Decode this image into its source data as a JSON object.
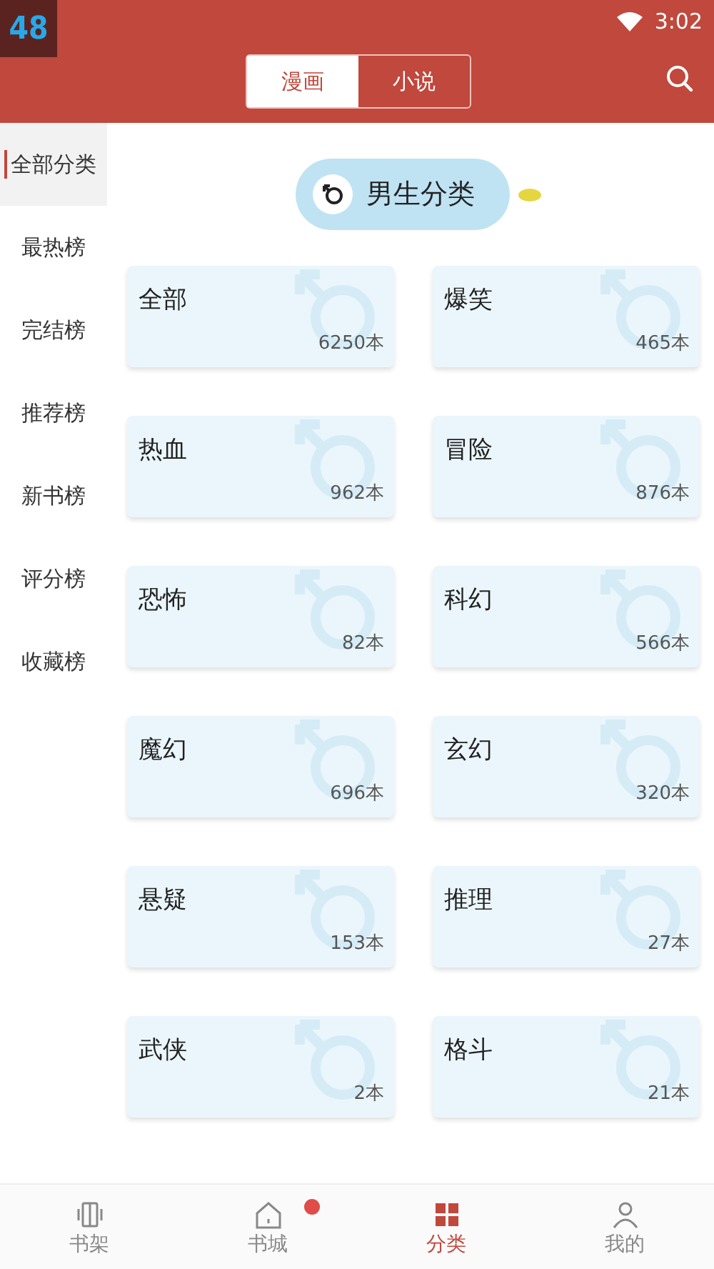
{
  "status_bar": {
    "badge": "48",
    "time": "3:02"
  },
  "header_tabs": [
    {
      "label": "漫画",
      "selected": true
    },
    {
      "label": "小说",
      "selected": false
    }
  ],
  "sidebar": {
    "items": [
      {
        "label": "全部分类",
        "selected": true
      },
      {
        "label": "最热榜",
        "selected": false
      },
      {
        "label": "完结榜",
        "selected": false
      },
      {
        "label": "推荐榜",
        "selected": false
      },
      {
        "label": "新书榜",
        "selected": false
      },
      {
        "label": "评分榜",
        "selected": false
      },
      {
        "label": "收藏榜",
        "selected": false
      }
    ]
  },
  "section_title": "男生分类",
  "categories": [
    {
      "name": "全部",
      "count": "6250本"
    },
    {
      "name": "爆笑",
      "count": "465本"
    },
    {
      "name": "热血",
      "count": "962本"
    },
    {
      "name": "冒险",
      "count": "876本"
    },
    {
      "name": "恐怖",
      "count": "82本"
    },
    {
      "name": "科幻",
      "count": "566本"
    },
    {
      "name": "魔幻",
      "count": "696本"
    },
    {
      "name": "玄幻",
      "count": "320本"
    },
    {
      "name": "悬疑",
      "count": "153本"
    },
    {
      "name": "推理",
      "count": "27本"
    },
    {
      "name": "武侠",
      "count": "2本"
    },
    {
      "name": "格斗",
      "count": "21本"
    }
  ],
  "bottom_nav": [
    {
      "label": "书架",
      "kind": "shelf",
      "selected": false,
      "dot": false
    },
    {
      "label": "书城",
      "kind": "home",
      "selected": false,
      "dot": true
    },
    {
      "label": "分类",
      "kind": "category",
      "selected": true,
      "dot": false
    },
    {
      "label": "我的",
      "kind": "profile",
      "selected": false,
      "dot": false
    }
  ]
}
